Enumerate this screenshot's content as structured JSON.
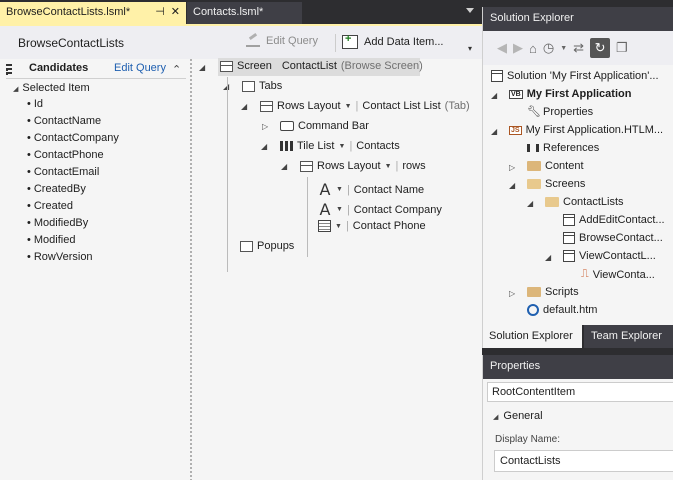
{
  "tabs": [
    {
      "label": "BrowseContactLists.lsml*",
      "pin": "⊣",
      "close": "✕"
    },
    {
      "label": "Contacts.lsml*"
    }
  ],
  "designer": {
    "title": "BrowseContactLists",
    "edit_query": "Edit Query",
    "add_data_item": "Add Data Item..."
  },
  "candidates": {
    "title": "Candidates",
    "edit_query": "Edit Query",
    "selected_item": "Selected Item",
    "fields": [
      "Id",
      "ContactName",
      "ContactCompany",
      "ContactPhone",
      "ContactEmail",
      "CreatedBy",
      "Created",
      "ModifiedBy",
      "Modified",
      "RowVersion"
    ]
  },
  "tree": {
    "screen_label": "Screen",
    "screen_name": "ContactList",
    "screen_type": "(Browse Screen)",
    "tabs": "Tabs",
    "rows_layout_1": "Rows Layout",
    "rows_layout_1_name": "Contact List List",
    "rows_layout_1_type": "(Tab)",
    "command_bar": "Command Bar",
    "tile_list": "Tile List",
    "tile_list_name": "Contacts",
    "rows_layout_2": "Rows Layout",
    "rows_layout_2_name": "rows",
    "contact_name": "Contact Name",
    "contact_company": "Contact Company",
    "contact_phone": "Contact Phone",
    "popups": "Popups"
  },
  "solution_explorer": {
    "title": "Solution Explorer",
    "solution": "Solution 'My First Application'...",
    "project": "My First Application",
    "properties": "Properties",
    "html_project": "My First Application.HTLM...",
    "references": "References",
    "content": "Content",
    "screens": "Screens",
    "contact_lists": "ContactLists",
    "add_edit": "AddEditContact...",
    "browse": "BrowseContact...",
    "view_folder": "ViewContactL...",
    "view_file": "ViewConta...",
    "scripts": "Scripts",
    "default_htm": "default.htm",
    "tab_active": "Solution Explorer",
    "tab_other": "Team Explorer"
  },
  "properties_panel": {
    "title": "Properties",
    "object": "RootContentItem",
    "section": "General",
    "display_name_label": "Display Name:",
    "display_name_value": "ContactLists"
  }
}
